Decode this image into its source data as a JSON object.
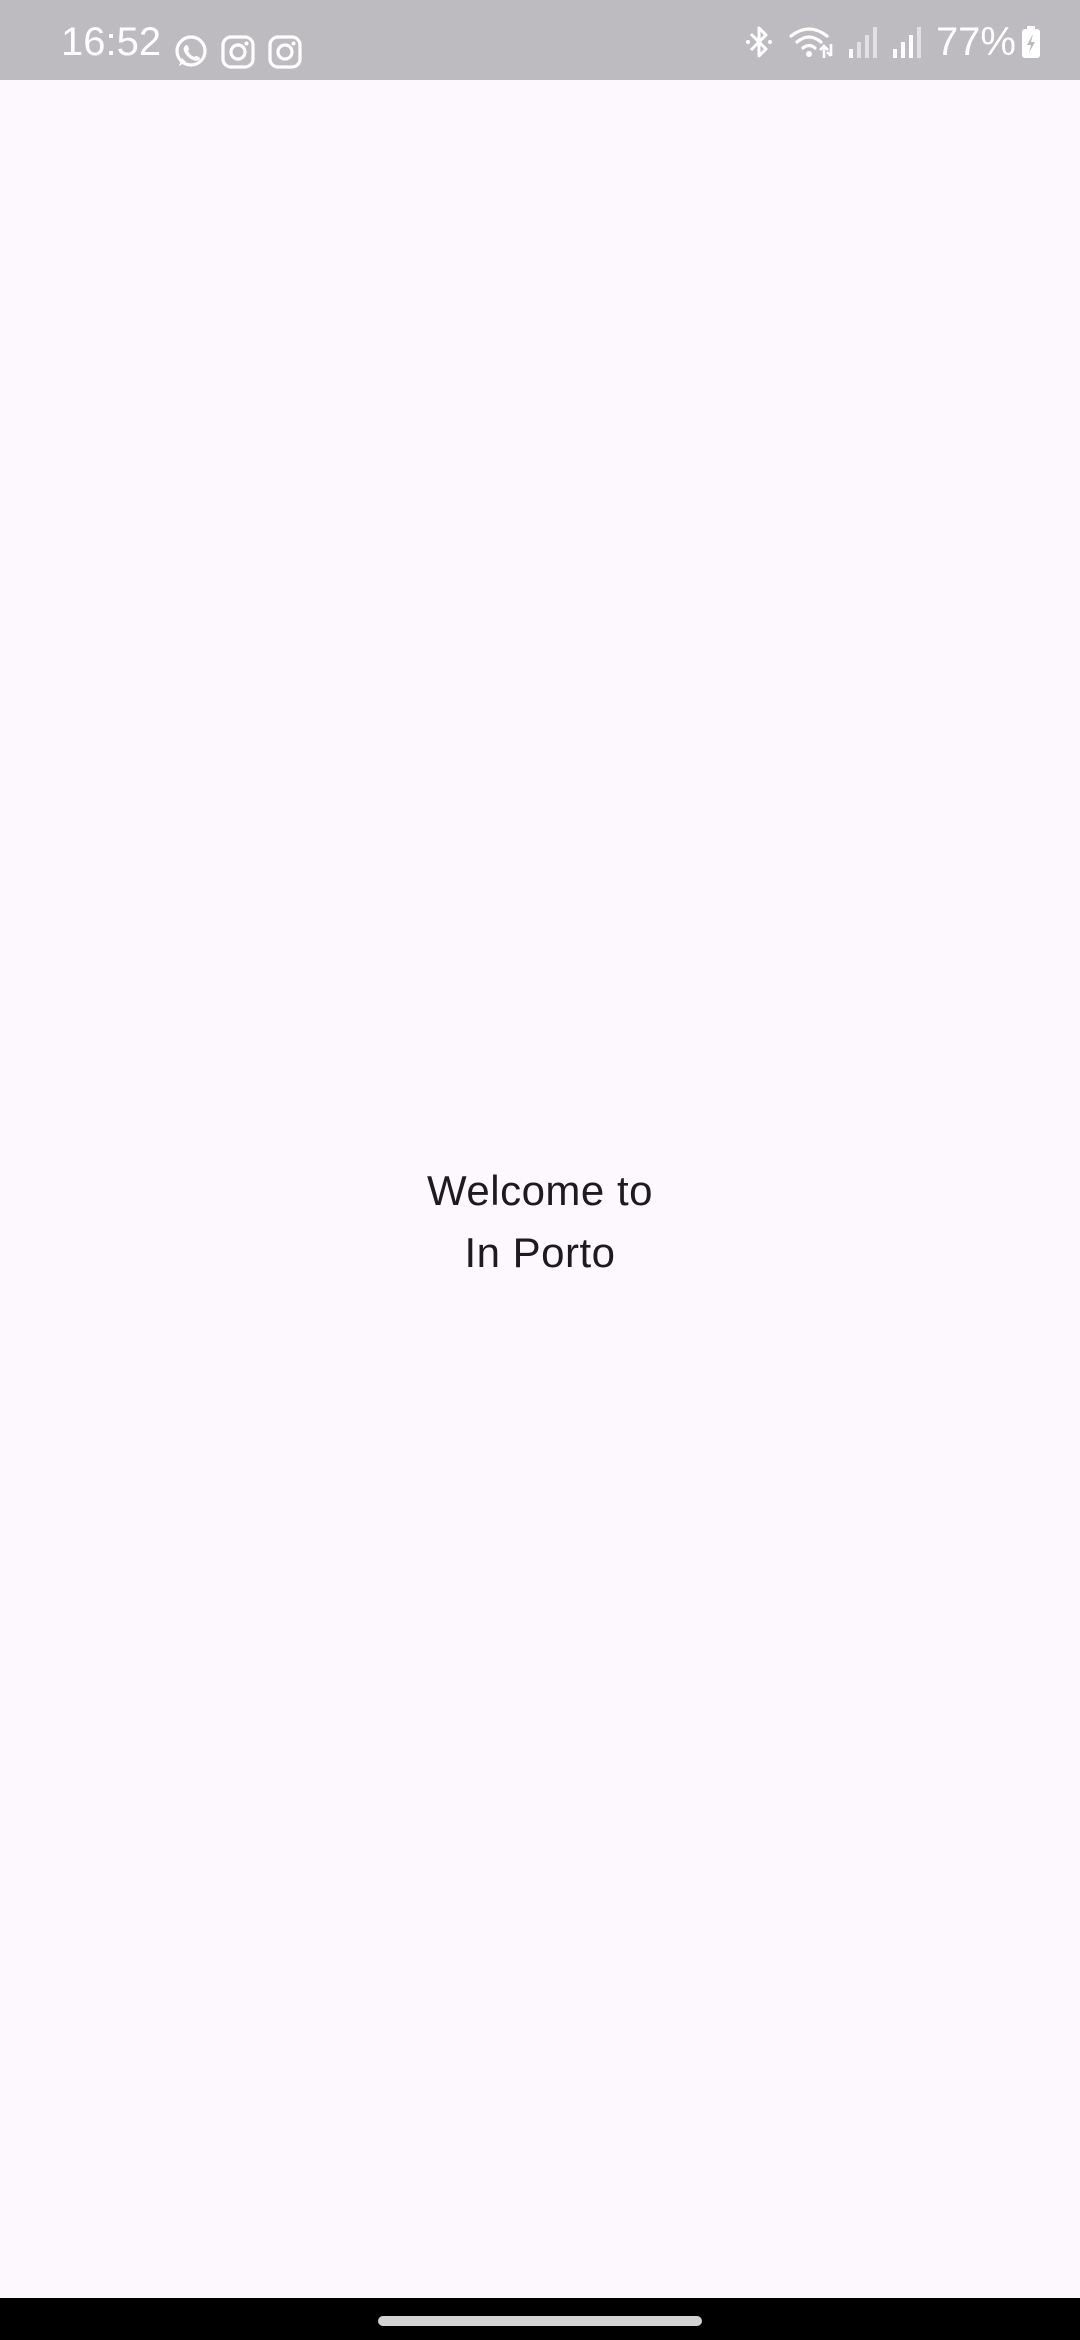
{
  "status_bar": {
    "time": "16:52",
    "notification_icons": [
      "whatsapp-icon",
      "instagram-icon",
      "instagram-icon"
    ],
    "system_icons": [
      "bluetooth-icon",
      "wifi-icon",
      "signal-icon",
      "signal-icon"
    ],
    "battery_percent": "77%",
    "battery_charging": true
  },
  "main": {
    "welcome_line1": "Welcome to",
    "welcome_line2": "In Porto"
  },
  "colors": {
    "status_bar_bg": "#bebbc0",
    "page_bg": "#fcf8fd",
    "text": "#1d1b20",
    "nav_bar_bg": "#000000"
  }
}
